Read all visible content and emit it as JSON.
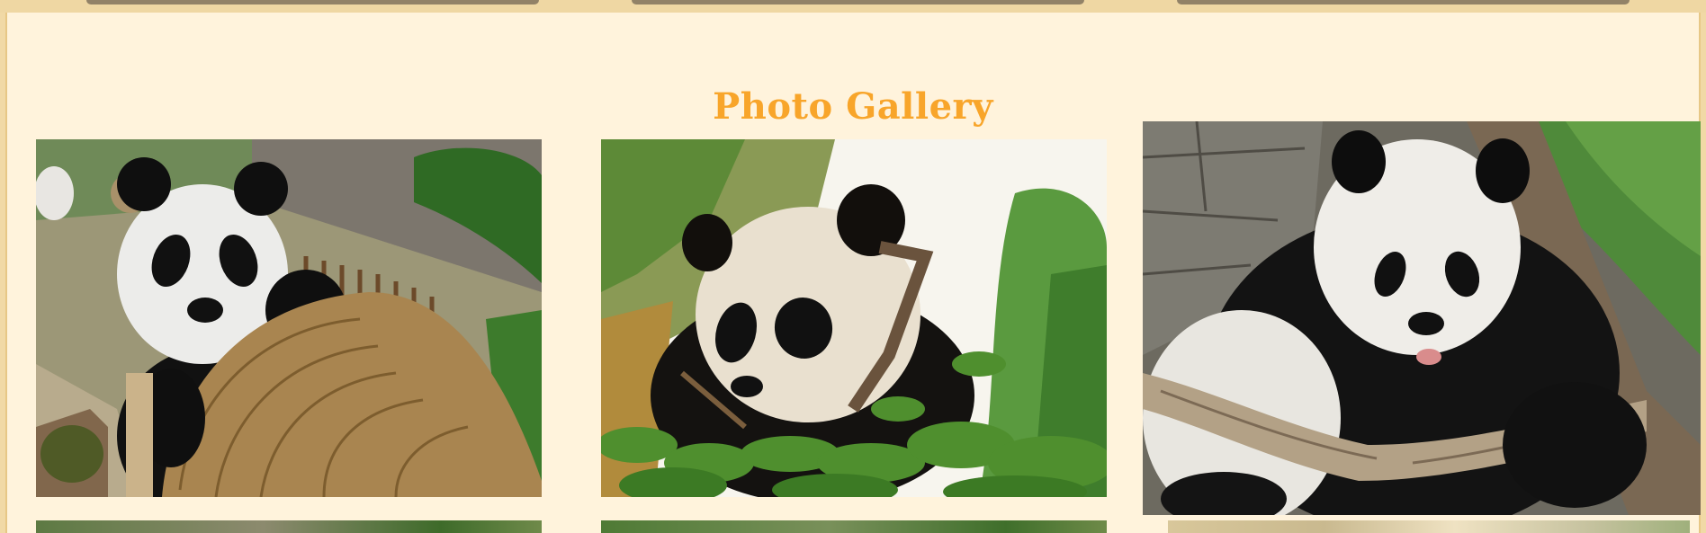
{
  "gallery": {
    "title": "Photo Gallery"
  },
  "colors": {
    "title": "#f8a52a",
    "panel_background": "#fff3dc",
    "page_background": "#f1d9a6"
  },
  "photos": [
    {
      "subject": "panda-with-basket"
    },
    {
      "subject": "panda-cub-in-branches"
    },
    {
      "subject": "panda-on-log"
    }
  ]
}
